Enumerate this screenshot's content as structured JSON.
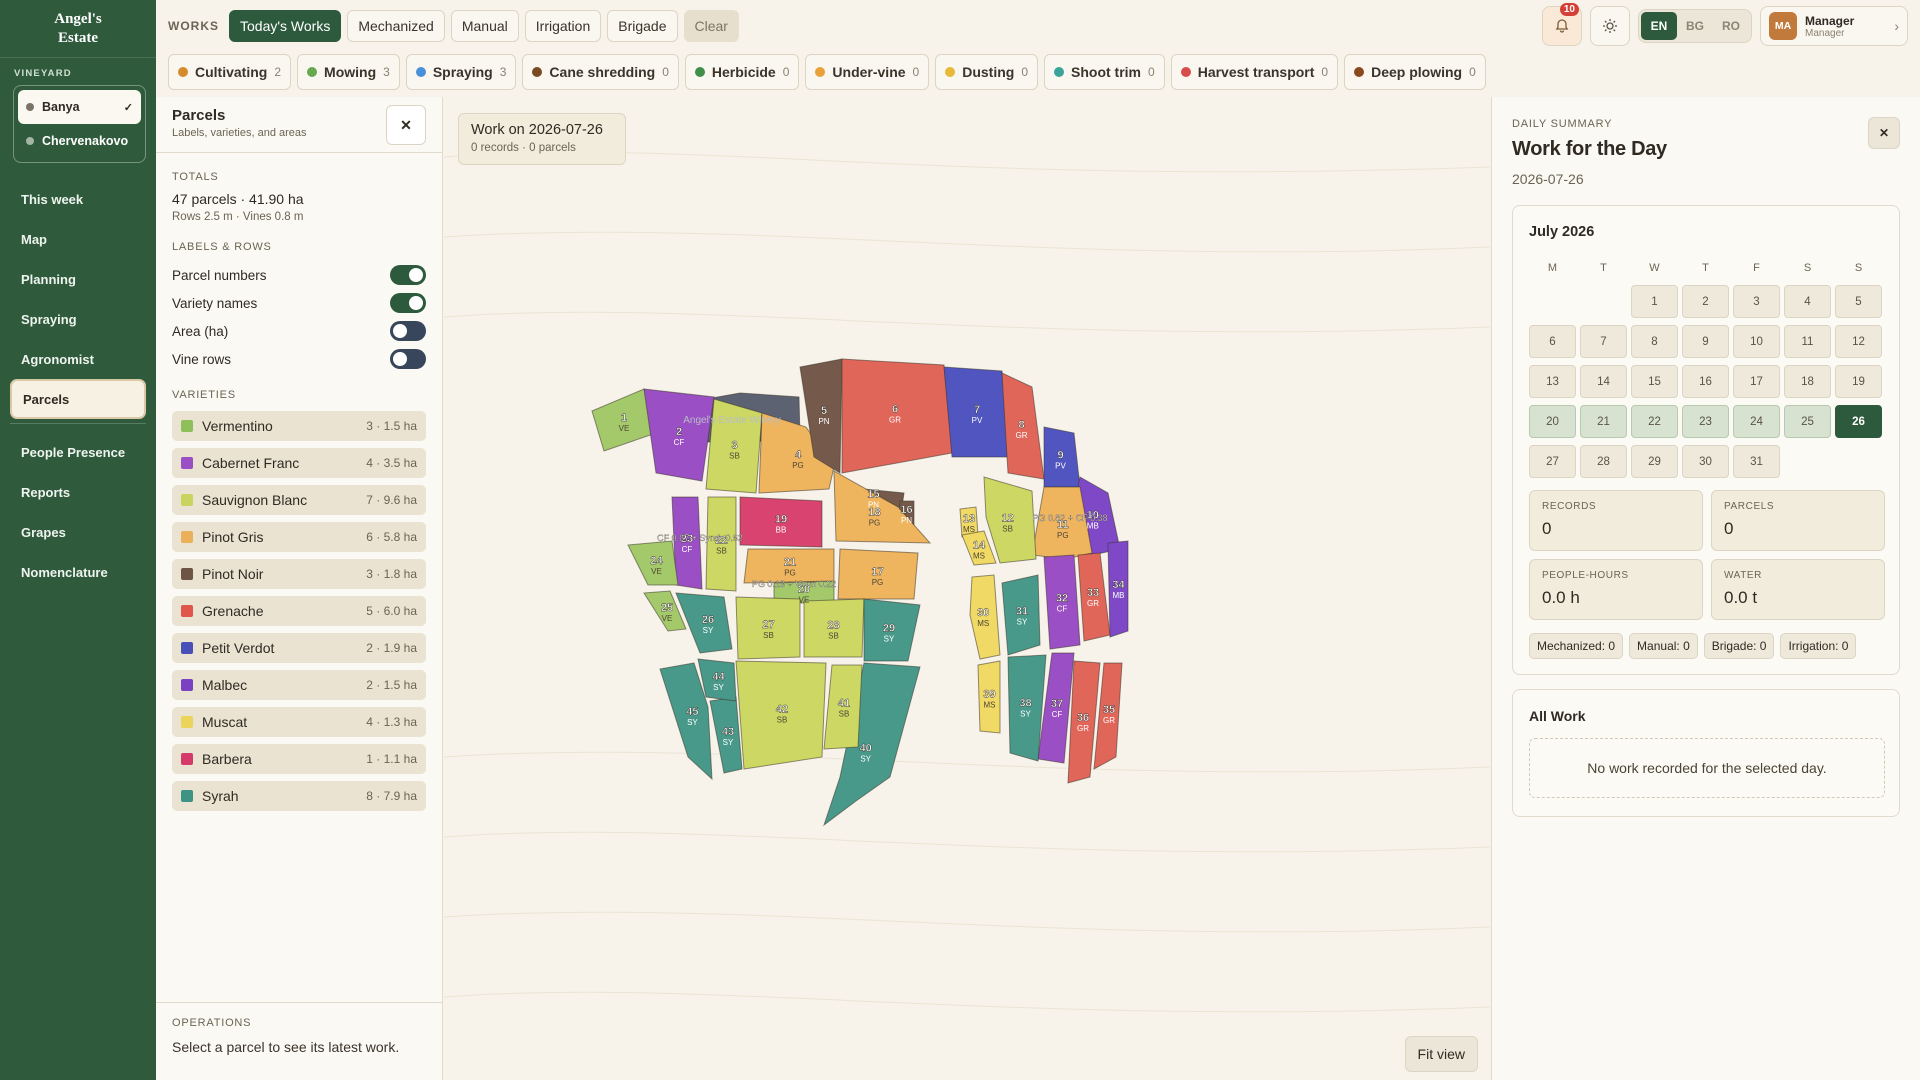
{
  "brand": {
    "line1": "Angel's",
    "line2": "Estate"
  },
  "sidebar": {
    "vineyard_label": "VINEYARD",
    "vineyards": [
      {
        "name": "Banya",
        "active": true
      },
      {
        "name": "Chervenakovo",
        "active": false
      }
    ],
    "nav_group1": [
      "This week",
      "Map",
      "Planning",
      "Spraying",
      "Agronomist",
      "Parcels"
    ],
    "nav_group2": [
      "People Presence",
      "Reports",
      "Grapes",
      "Nomenclature"
    ],
    "active_item": "Parcels"
  },
  "toolbar": {
    "works_label": "WORKS",
    "filters": [
      "Today's Works",
      "Mechanized",
      "Manual",
      "Irrigation",
      "Brigade"
    ],
    "clear_label": "Clear"
  },
  "categories": [
    {
      "name": "Cultivating",
      "count": "2",
      "color": "#d68a2a"
    },
    {
      "name": "Mowing",
      "count": "3",
      "color": "#6aa84f"
    },
    {
      "name": "Spraying",
      "count": "3",
      "color": "#4a90d9"
    },
    {
      "name": "Cane shredding",
      "count": "0",
      "color": "#7a4a22"
    },
    {
      "name": "Herbicide",
      "count": "0",
      "color": "#3f8f4a"
    },
    {
      "name": "Under-vine",
      "count": "0",
      "color": "#e7a23a"
    },
    {
      "name": "Dusting",
      "count": "0",
      "color": "#e8b838"
    },
    {
      "name": "Shoot trim",
      "count": "0",
      "color": "#3aa39a"
    },
    {
      "name": "Harvest transport",
      "count": "0",
      "color": "#d94c4c"
    },
    {
      "name": "Deep plowing",
      "count": "0",
      "color": "#8a4a1e"
    }
  ],
  "notifications": {
    "count": "10"
  },
  "languages": [
    "EN",
    "BG",
    "RO"
  ],
  "active_language": "EN",
  "user": {
    "initials": "MA",
    "name": "Manager",
    "role": "Manager"
  },
  "parcels_panel": {
    "title": "Parcels",
    "subtitle": "Labels, varieties, and areas",
    "totals_label": "TOTALS",
    "totals": "47 parcels · 41.90 ha",
    "totals_sub": "Rows 2.5 m · Vines 0.8 m",
    "labels_label": "LABELS & ROWS",
    "toggles": [
      {
        "label": "Parcel numbers",
        "on": true
      },
      {
        "label": "Variety names",
        "on": true
      },
      {
        "label": "Area (ha)",
        "on": false
      },
      {
        "label": "Vine rows",
        "on": false
      }
    ],
    "varieties_label": "VARIETIES",
    "varieties": [
      {
        "name": "Vermentino",
        "info": "3 · 1.5 ha",
        "color": "#8fbf5a"
      },
      {
        "name": "Cabernet Franc",
        "info": "4 · 3.5 ha",
        "color": "#9b4fc4"
      },
      {
        "name": "Sauvignon Blanc",
        "info": "7 · 9.6 ha",
        "color": "#c8d45e"
      },
      {
        "name": "Pinot Gris",
        "info": "6 · 5.8 ha",
        "color": "#eab05a"
      },
      {
        "name": "Pinot Noir",
        "info": "3 · 1.8 ha",
        "color": "#6e5444"
      },
      {
        "name": "Grenache",
        "info": "5 · 6.0 ha",
        "color": "#e0564a"
      },
      {
        "name": "Petit Verdot",
        "info": "2 · 1.9 ha",
        "color": "#4a4fb8"
      },
      {
        "name": "Malbec",
        "info": "2 · 1.5 ha",
        "color": "#7a42c2"
      },
      {
        "name": "Muscat",
        "info": "4 · 1.3 ha",
        "color": "#ecd45a"
      },
      {
        "name": "Barbera",
        "info": "1 · 1.1 ha",
        "color": "#d43a6a"
      },
      {
        "name": "Syrah",
        "info": "8 · 7.9 ha",
        "color": "#3e9484"
      }
    ],
    "operations_label": "OPERATIONS",
    "operations_text": "Select a parcel to see its latest work."
  },
  "map": {
    "work_title": "Work on 2026-07-26",
    "work_sub": "0 records · 0 parcels",
    "fit_label": "Fit view",
    "winery_label": "Angel's Estate Winery",
    "mixed_labels": [
      "CF 0.67 + Syrah 0.62",
      "PG 0.82 + CF 0.38",
      "PG 0.13 + Verm 0.22"
    ],
    "parcels": [
      {
        "n": "1",
        "v": "VE"
      },
      {
        "n": "2",
        "v": "CF"
      },
      {
        "n": "3",
        "v": "SB"
      },
      {
        "n": "4",
        "v": "PG"
      },
      {
        "n": "5",
        "v": "PN"
      },
      {
        "n": "6",
        "v": "GR"
      },
      {
        "n": "7",
        "v": "PV"
      },
      {
        "n": "8",
        "v": "GR"
      },
      {
        "n": "9",
        "v": "PV"
      },
      {
        "n": "10",
        "v": "MB"
      },
      {
        "n": "11",
        "v": "PG"
      },
      {
        "n": "12",
        "v": "SB"
      },
      {
        "n": "13",
        "v": "MS"
      },
      {
        "n": "14",
        "v": "MS"
      },
      {
        "n": "15",
        "v": "PN"
      },
      {
        "n": "16",
        "v": "PN"
      },
      {
        "n": "17",
        "v": "PG"
      },
      {
        "n": "18",
        "v": "PG"
      },
      {
        "n": "19",
        "v": "BB"
      },
      {
        "n": "20",
        "v": "VE"
      },
      {
        "n": "21",
        "v": "PG"
      },
      {
        "n": "22",
        "v": "SB"
      },
      {
        "n": "23",
        "v": "CF"
      },
      {
        "n": "24",
        "v": "VE"
      },
      {
        "n": "25",
        "v": "VE"
      },
      {
        "n": "26",
        "v": "SY"
      },
      {
        "n": "27",
        "v": "SB"
      },
      {
        "n": "28",
        "v": "SB"
      },
      {
        "n": "29",
        "v": "SY"
      },
      {
        "n": "30",
        "v": "MS"
      },
      {
        "n": "31",
        "v": "SY"
      },
      {
        "n": "32",
        "v": "CF"
      },
      {
        "n": "33",
        "v": "GR"
      },
      {
        "n": "34",
        "v": "MB"
      },
      {
        "n": "35",
        "v": "GR"
      },
      {
        "n": "36",
        "v": "GR"
      },
      {
        "n": "37",
        "v": "CF"
      },
      {
        "n": "38",
        "v": "SY"
      },
      {
        "n": "39",
        "v": "MS"
      },
      {
        "n": "40",
        "v": "SY"
      },
      {
        "n": "41",
        "v": "SB"
      },
      {
        "n": "42",
        "v": "SB"
      },
      {
        "n": "43",
        "v": "SY"
      },
      {
        "n": "44",
        "v": "SY"
      },
      {
        "n": "45",
        "v": "SY"
      }
    ]
  },
  "summary": {
    "label": "DAILY SUMMARY",
    "title": "Work for the Day",
    "date": "2026-07-26",
    "month": "July 2026",
    "weekdays": [
      "M",
      "T",
      "W",
      "T",
      "F",
      "S",
      "S"
    ],
    "days": [
      "",
      "",
      "1",
      "2",
      "3",
      "4",
      "5",
      "6",
      "7",
      "8",
      "9",
      "10",
      "11",
      "12",
      "13",
      "14",
      "15",
      "16",
      "17",
      "18",
      "19",
      "20",
      "21",
      "22",
      "23",
      "24",
      "25",
      "26",
      "27",
      "28",
      "29",
      "30",
      "31"
    ],
    "selected_day": "26",
    "week_days": [
      "20",
      "21",
      "22",
      "23",
      "24",
      "25"
    ],
    "stats": [
      {
        "label": "RECORDS",
        "value": "0"
      },
      {
        "label": "PARCELS",
        "value": "0"
      },
      {
        "label": "PEOPLE-HOURS",
        "value": "0.0 h"
      },
      {
        "label": "WATER",
        "value": "0.0 t"
      }
    ],
    "chips": [
      "Mechanized: 0",
      "Manual: 0",
      "Brigade: 0",
      "Irrigation: 0"
    ],
    "all_work_title": "All Work",
    "empty_text": "No work recorded for the selected day."
  }
}
